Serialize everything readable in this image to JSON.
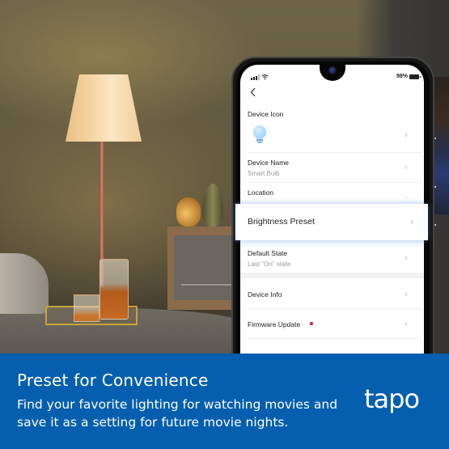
{
  "status_bar": {
    "battery_percent": "98%",
    "signal_icon": "cellular-signal-icon",
    "wifi_icon": "wifi-icon",
    "battery_icon": "battery-icon"
  },
  "screen": {
    "back_icon": "chevron-left-icon",
    "rows": [
      {
        "label": "Device Icon",
        "icon": "light-bulb-icon"
      },
      {
        "label": "Device Name",
        "value": "Smart Bulb"
      },
      {
        "label": "Location"
      },
      {
        "label": "Brightness Preset",
        "highlighted": true
      },
      {
        "label": "Default State",
        "value": "Last \"On\" state"
      },
      {
        "label": "Device Info"
      },
      {
        "label": "Firmware Update",
        "badge": "red-dot"
      }
    ],
    "chevron_icon": "chevron-right-icon"
  },
  "banner": {
    "title": "Preset for Convenience",
    "description": "Find your favorite lighting for watching movies and save it as a setting for future movie nights.",
    "logo": "tapo",
    "background_color": "#055fae"
  }
}
